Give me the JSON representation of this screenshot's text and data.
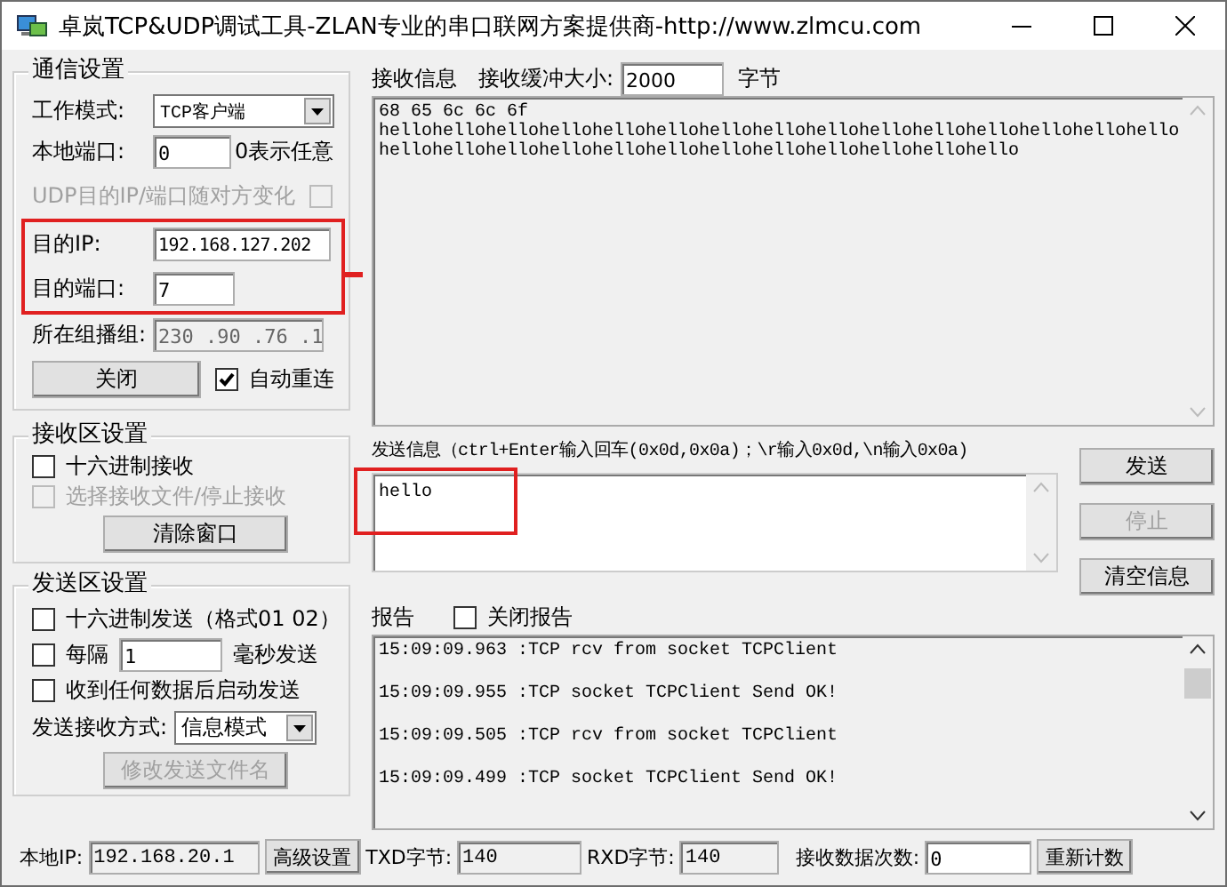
{
  "window": {
    "title": "卓岚TCP&UDP调试工具-ZLAN专业的串口联网方案提供商-http://www.zlmcu.com"
  },
  "comm_settings": {
    "title": "通信设置",
    "work_mode": {
      "label": "工作模式:",
      "value": "TCP客户端"
    },
    "local_port": {
      "label": "本地端口:",
      "value": "0",
      "hint": "0表示任意"
    },
    "udp_follow": {
      "label": "UDP目的IP/端口随对方变化",
      "checked": false,
      "disabled": true
    },
    "dest_ip": {
      "label": "目的IP:",
      "value": "192.168.127.202"
    },
    "dest_port": {
      "label": "目的端口:",
      "value": "7"
    },
    "multicast": {
      "label": "所在组播组:",
      "value": "230 .90 .76 .1",
      "disabled": true
    },
    "close_button": "关闭",
    "auto_reconnect": {
      "label": "自动重连",
      "checked": true
    }
  },
  "receive_settings": {
    "title": "接收区设置",
    "options": [
      {
        "label": "十六进制接收",
        "checked": false,
        "disabled": false
      },
      {
        "label": "选择接收文件/停止接收",
        "checked": false,
        "disabled": true
      }
    ],
    "clear_button": "清除窗口"
  },
  "send_settings": {
    "title": "发送区设置",
    "options": [
      {
        "kind": "checkbox",
        "label": "十六进制发送（格式01 02）",
        "checked": false
      },
      {
        "kind": "interval",
        "label": "每隔",
        "checked": false,
        "value": "1",
        "unit": "毫秒发送"
      },
      {
        "kind": "checkbox",
        "label": "收到任何数据后启动发送",
        "checked": false
      }
    ],
    "mode": {
      "label": "发送接收方式:",
      "value": "信息模式"
    },
    "rename_button": {
      "label": "修改发送文件名",
      "disabled": true
    }
  },
  "receive": {
    "label": "接收信息",
    "buffer_label": "接收缓冲大小:",
    "buffer_value": "2000",
    "unit": "字节",
    "lines": [
      "68 65 6c 6c 6f",
      "hellohellohellohellohellohellohellohellohellohellohellohellohellohellohello",
      "hellohellohellohellohellohellohellohellohellohellohellohello"
    ]
  },
  "send": {
    "label": "发送信息（ctrl+Enter输入回车(0x0d,0x0a)；\\r输入0x0d,\\n输入0x0a)",
    "value": "hello"
  },
  "buttons": [
    {
      "label": "发送",
      "disabled": false
    },
    {
      "label": "停止",
      "disabled": true
    },
    {
      "label": "清空信息",
      "disabled": false
    }
  ],
  "report": {
    "label": "报告",
    "close_report": {
      "label": "关闭报告",
      "checked": false
    },
    "entries": [
      "15:09:09.963 :TCP rcv from socket TCPClient",
      "15:09:09.955 :TCP socket TCPClient Send OK!",
      "15:09:09.505 :TCP rcv from socket TCPClient",
      "15:09:09.499 :TCP socket TCPClient Send OK!"
    ]
  },
  "status_bar": {
    "local_ip_label": "本地IP:",
    "local_ip": "192.168.20.1",
    "advanced_button": "高级设置",
    "txd_label": "TXD字节:",
    "txd": "140",
    "rxd_label": "RXD字节:",
    "rxd": "140",
    "count_label": "接收数据次数:",
    "count": "0",
    "reset_button": "重新计数"
  }
}
